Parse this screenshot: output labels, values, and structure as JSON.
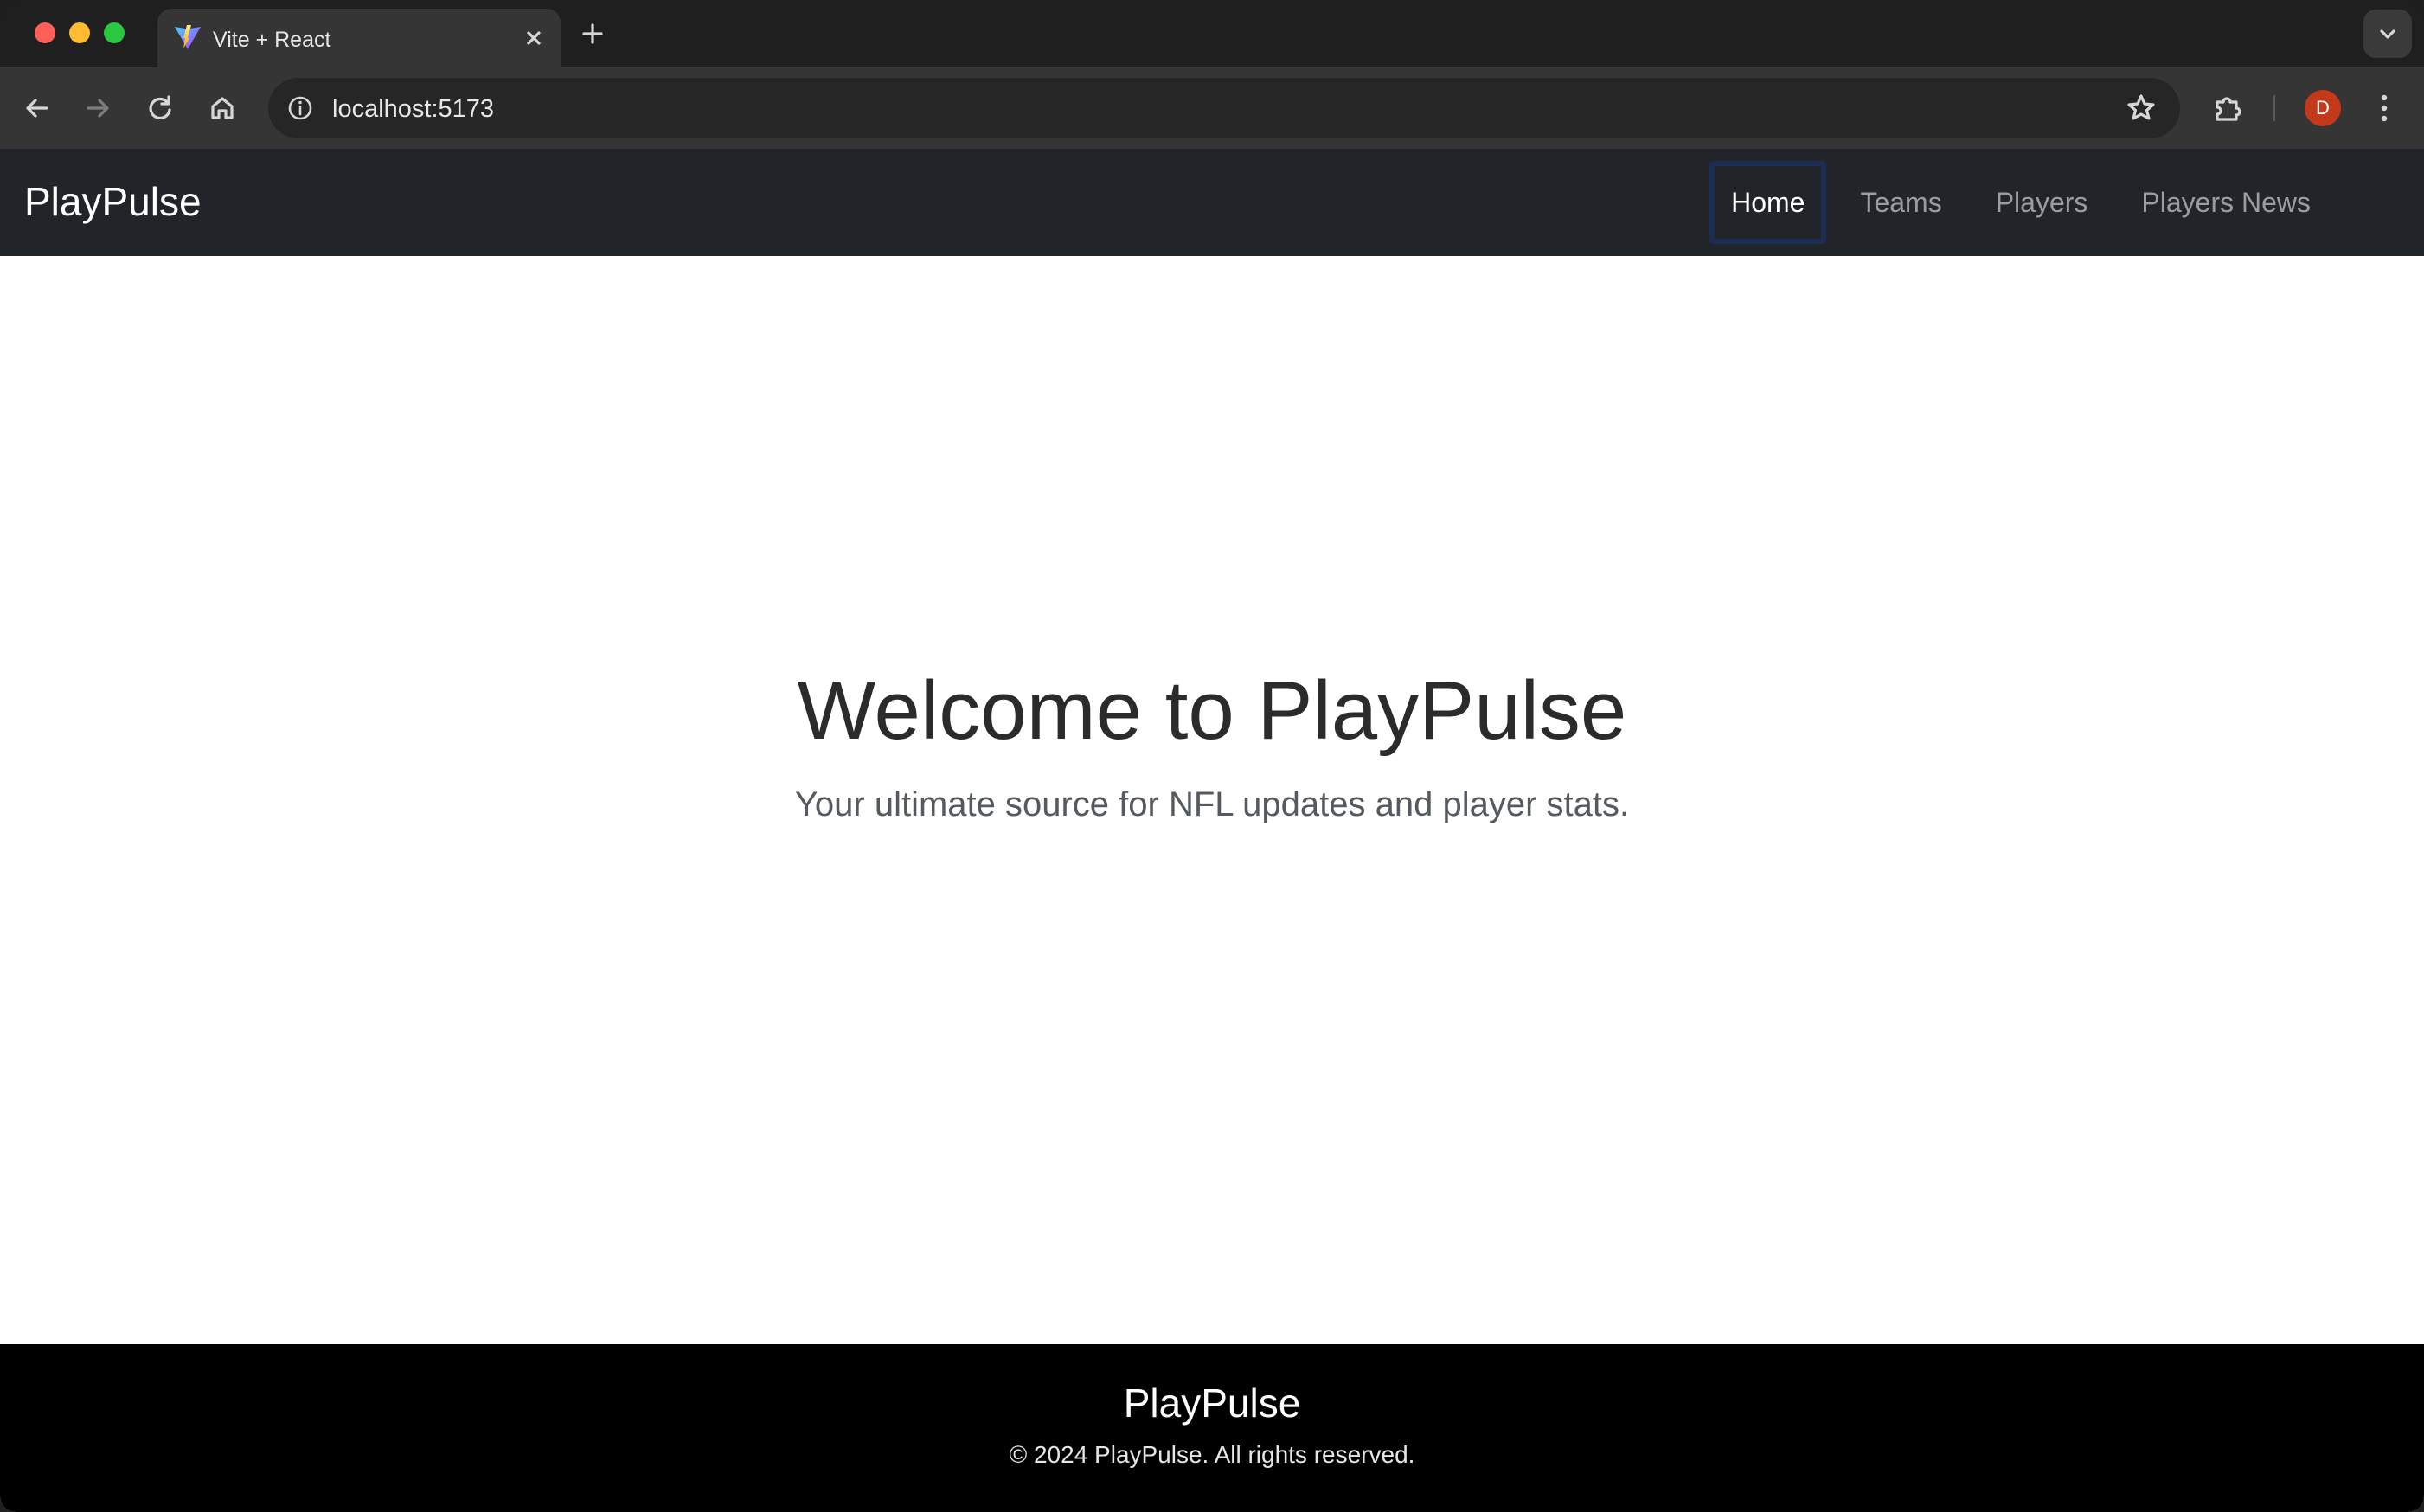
{
  "browser": {
    "tab": {
      "title": "Vite + React",
      "favicon": "vite-icon",
      "close_icon": "close-icon"
    },
    "new_tab_icon": "plus-icon",
    "tab_search_icon": "chevron-down-icon",
    "toolbar": {
      "back_icon": "arrow-left-icon",
      "forward_icon": "arrow-right-icon",
      "reload_icon": "reload-icon",
      "home_icon": "home-icon",
      "site_info_icon": "info-icon",
      "url": "localhost:5173",
      "bookmark_icon": "star-icon",
      "extensions_icon": "puzzle-icon",
      "profile_initial": "D",
      "menu_icon": "kebab-menu-icon"
    }
  },
  "app": {
    "navbar": {
      "brand": "PlayPulse",
      "links": [
        {
          "label": "Home",
          "active": true
        },
        {
          "label": "Teams",
          "active": false
        },
        {
          "label": "Players",
          "active": false
        },
        {
          "label": "Players News",
          "active": false
        }
      ]
    },
    "hero": {
      "title": "Welcome to PlayPulse",
      "subtitle": "Your ultimate source for NFL updates and player stats."
    },
    "footer": {
      "brand": "PlayPulse",
      "copyright": "© 2024 PlayPulse. All rights reserved."
    }
  },
  "colors": {
    "navbar_bg": "#212529",
    "footer_bg": "#000000",
    "active_focus_ring": "#1c2c53",
    "profile_avatar": "#c5391b"
  }
}
